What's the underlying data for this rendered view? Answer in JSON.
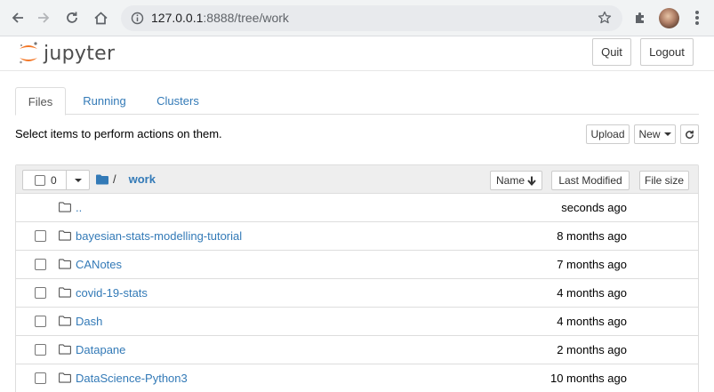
{
  "browser": {
    "url_host": "127.0.0.1",
    "url_path": ":8888/tree/work"
  },
  "header": {
    "logo_text": "jupyter",
    "quit_label": "Quit",
    "logout_label": "Logout"
  },
  "tabs": [
    {
      "label": "Files",
      "active": true
    },
    {
      "label": "Running",
      "active": false
    },
    {
      "label": "Clusters",
      "active": false
    }
  ],
  "toolbar": {
    "instructions": "Select items to perform actions on them.",
    "upload_label": "Upload",
    "new_label": "New"
  },
  "list_header": {
    "selected_count": "0",
    "root_separator": "/",
    "current_dir": "work",
    "sort_name_label": "Name",
    "sort_modified_label": "Last Modified",
    "sort_size_label": "File size"
  },
  "rows": [
    {
      "name": "..",
      "modified": "seconds ago",
      "checkbox": false
    },
    {
      "name": "bayesian-stats-modelling-tutorial",
      "modified": "8 months ago",
      "checkbox": true
    },
    {
      "name": "CANotes",
      "modified": "7 months ago",
      "checkbox": true
    },
    {
      "name": "covid-19-stats",
      "modified": "4 months ago",
      "checkbox": true
    },
    {
      "name": "Dash",
      "modified": "4 months ago",
      "checkbox": true
    },
    {
      "name": "Datapane",
      "modified": "2 months ago",
      "checkbox": true
    },
    {
      "name": "DataScience-Python3",
      "modified": "10 months ago",
      "checkbox": true
    }
  ],
  "colors": {
    "link": "#337ab7",
    "logo_orange": "#f37726"
  }
}
